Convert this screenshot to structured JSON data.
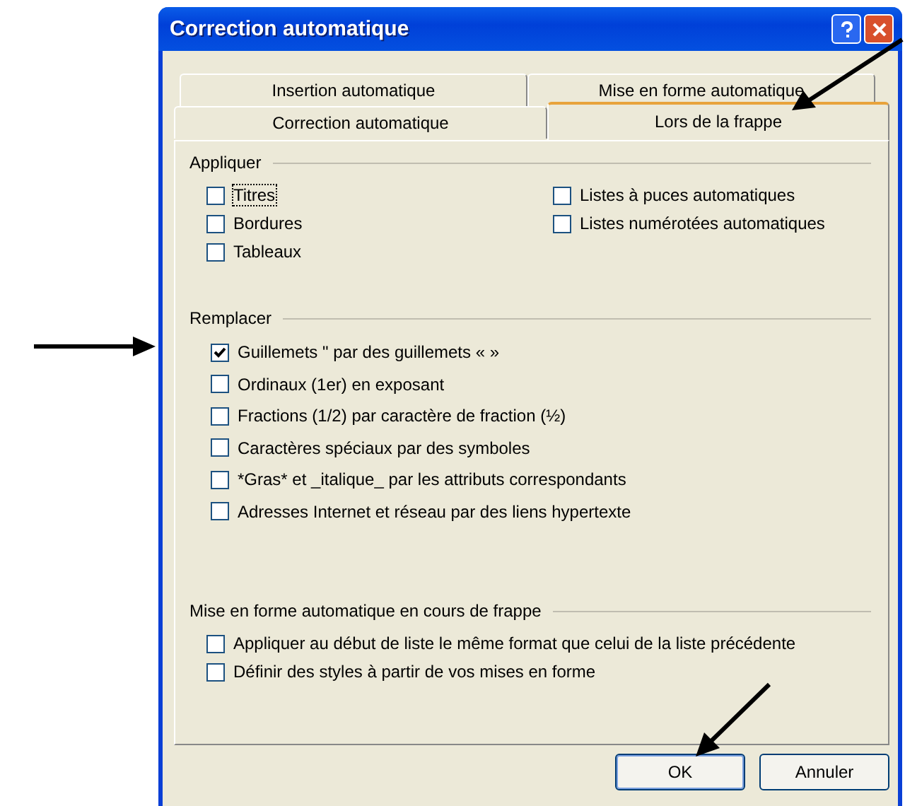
{
  "window": {
    "title": "Correction automatique"
  },
  "tab_rows": [
    [
      {
        "label": "Insertion automatique",
        "selected": false
      },
      {
        "label": "Mise en forme automatique",
        "selected": false
      }
    ],
    [
      {
        "label": "Correction automatique",
        "selected": false
      },
      {
        "label": "Lors de la frappe",
        "selected": true
      }
    ]
  ],
  "groups": [
    {
      "title": "Appliquer",
      "columns": [
        [
          {
            "label": "Titres",
            "checked": false,
            "focused": true
          },
          {
            "label": "Bordures",
            "checked": false
          },
          {
            "label": "Tableaux",
            "checked": false
          }
        ],
        [
          {
            "label": "Listes à puces automatiques",
            "checked": false
          },
          {
            "label": "Listes numérotées automatiques",
            "checked": false
          }
        ]
      ]
    },
    {
      "title": "Remplacer",
      "columns": [
        [
          {
            "label": "Guillemets \" par des guillemets « »",
            "checked": true
          },
          {
            "label": "Ordinaux (1er) en exposant",
            "checked": false
          },
          {
            "label": "Fractions (1/2) par caractère de fraction (½)",
            "checked": false
          },
          {
            "label": "Caractères spéciaux par des symboles",
            "checked": false
          },
          {
            "label": "*Gras* et _italique_ par les attributs correspondants",
            "checked": false
          },
          {
            "label": "Adresses Internet et réseau par des liens hypertexte",
            "checked": false
          }
        ]
      ]
    },
    {
      "title": "Mise en forme automatique en cours de frappe",
      "columns": [
        [
          {
            "label": "Appliquer au début de liste le même format que celui de la liste précédente",
            "checked": false
          },
          {
            "label": "Définir des styles à partir de vos mises en forme",
            "checked": false
          }
        ]
      ]
    }
  ],
  "buttons": [
    {
      "label": "OK",
      "default": true
    },
    {
      "label": "Annuler",
      "default": false
    }
  ]
}
